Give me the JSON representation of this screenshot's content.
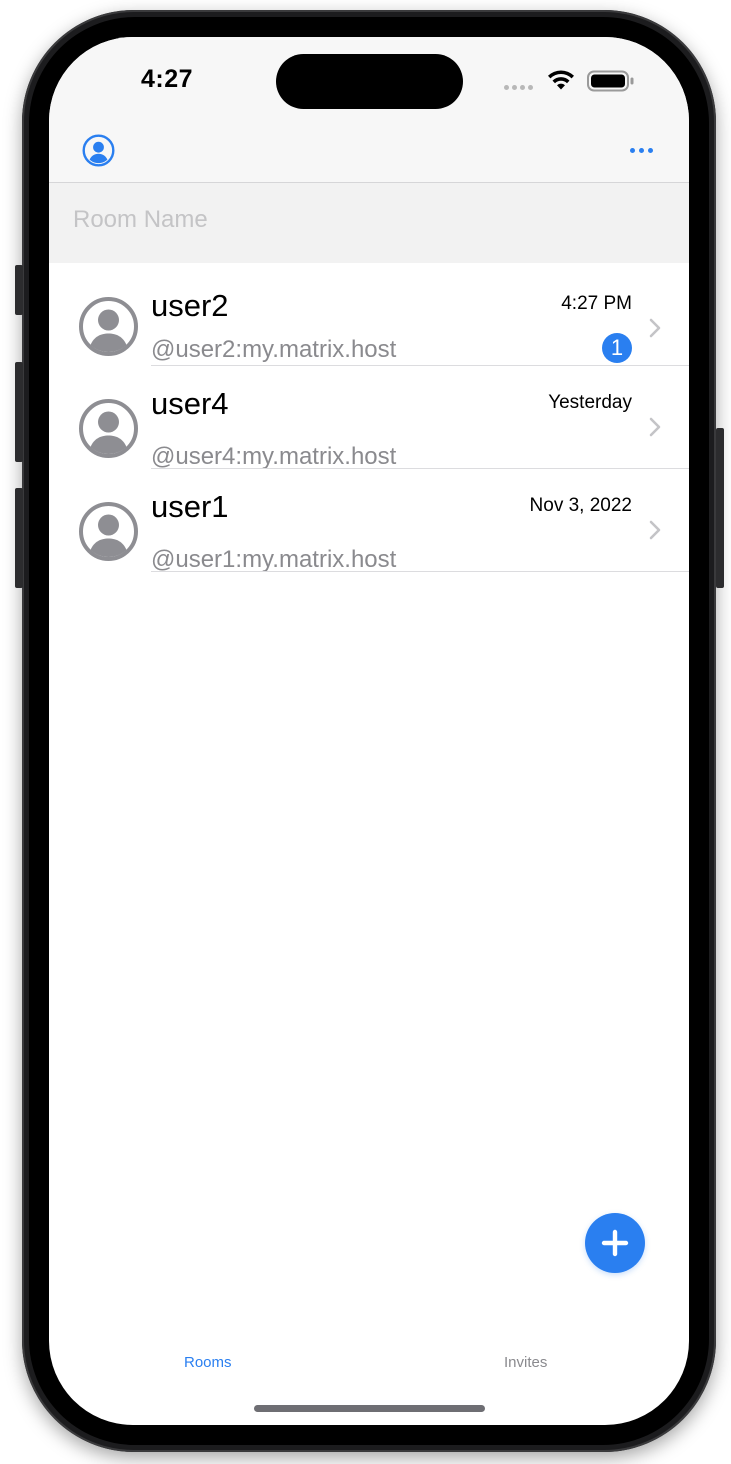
{
  "status_bar": {
    "time": "4:27"
  },
  "nav_bar": {
    "left_icon": "person-circle-icon",
    "right_icon": "ellipsis-icon"
  },
  "search": {
    "placeholder": "Room Name",
    "value": ""
  },
  "rooms": [
    {
      "name": "user2",
      "id": "@user2:my.matrix.host",
      "time": "4:27 PM",
      "unread": "1"
    },
    {
      "name": "user4",
      "id": "@user4:my.matrix.host",
      "time": "Yesterday"
    },
    {
      "name": "user1",
      "id": "@user1:my.matrix.host",
      "time": "Nov 3, 2022"
    }
  ],
  "fab": {
    "icon": "plus-icon"
  },
  "tabs": [
    {
      "label": "Rooms",
      "selected": true
    },
    {
      "label": "Invites",
      "selected": false
    }
  ],
  "colors": {
    "accent": "#2a7ff0",
    "secondary_text": "#8a8a8e",
    "avatar_gray": "#8e8e93"
  }
}
